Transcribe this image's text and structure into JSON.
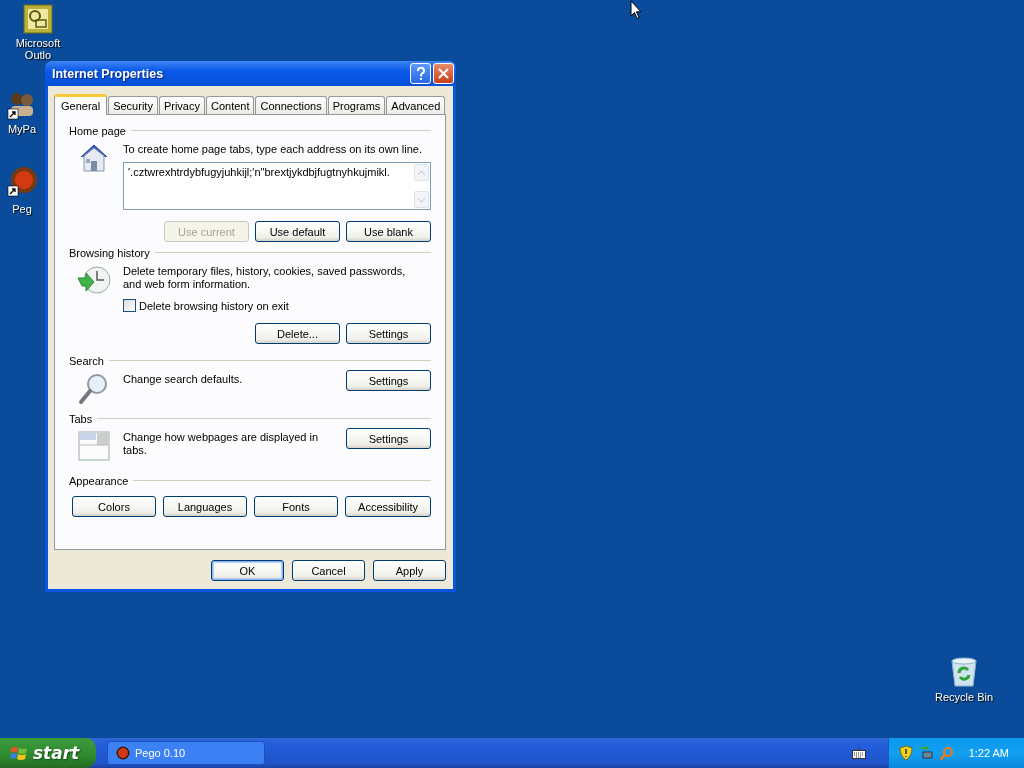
{
  "desktop_icons": [
    {
      "kind": "outlook",
      "lines": [
        "Microsoft",
        "Outlo"
      ]
    },
    {
      "kind": "mypage",
      "lines": [
        "MyPa"
      ]
    },
    {
      "kind": "pego",
      "lines": [
        "Peg"
      ]
    },
    {
      "kind": "recycle_bin",
      "lines": [
        "Recycle Bin"
      ]
    }
  ],
  "window": {
    "title": "Internet Properties",
    "tabs": [
      {
        "label": "General",
        "selected": true
      },
      {
        "label": "Security",
        "selected": false
      },
      {
        "label": "Privacy",
        "selected": false
      },
      {
        "label": "Content",
        "selected": false
      },
      {
        "label": "Connections",
        "selected": false
      },
      {
        "label": "Programs",
        "selected": false
      },
      {
        "label": "Advanced",
        "selected": false
      }
    ],
    "sections": [
      {
        "kind": "home",
        "heading": "Home page",
        "description": "To create home page tabs, type each address on its own line.",
        "address": "'.cztwrexhtrdybfugyjuhkijl;'n\"brextjykdbjfugtnyhkujmikl.",
        "buttons": [
          {
            "label": "Use current",
            "disabled": true
          },
          {
            "label": "Use default",
            "disabled": false
          },
          {
            "label": "Use blank",
            "disabled": false
          }
        ]
      },
      {
        "kind": "history",
        "heading": "Browsing history",
        "description": "Delete temporary files, history, cookies, saved passwords, and web form information.",
        "checkbox": {
          "label": "Delete browsing history on exit",
          "checked": false
        },
        "buttons": [
          {
            "label": "Delete...",
            "disabled": false
          },
          {
            "label": "Settings",
            "disabled": false
          }
        ]
      },
      {
        "kind": "search",
        "heading": "Search",
        "description": "Change search defaults.",
        "buttons": [
          {
            "label": "Settings",
            "disabled": false
          }
        ]
      },
      {
        "kind": "tabs",
        "heading": "Tabs",
        "description": "Change how webpages are displayed in tabs.",
        "buttons": [
          {
            "label": "Settings",
            "disabled": false
          }
        ]
      },
      {
        "kind": "appearance",
        "heading": "Appearance",
        "buttons": [
          {
            "label": "Colors",
            "disabled": false
          },
          {
            "label": "Languages",
            "disabled": false
          },
          {
            "label": "Fonts",
            "disabled": false
          },
          {
            "label": "Accessibility",
            "disabled": false
          }
        ]
      }
    ],
    "footer_buttons": [
      {
        "label": "OK",
        "default": true
      },
      {
        "label": "Cancel",
        "default": false
      },
      {
        "label": "Apply",
        "default": false
      }
    ]
  },
  "taskbar": {
    "start": "start",
    "tasks": [
      {
        "label": "Pego 0.10"
      }
    ],
    "clock": "1:22 AM"
  }
}
